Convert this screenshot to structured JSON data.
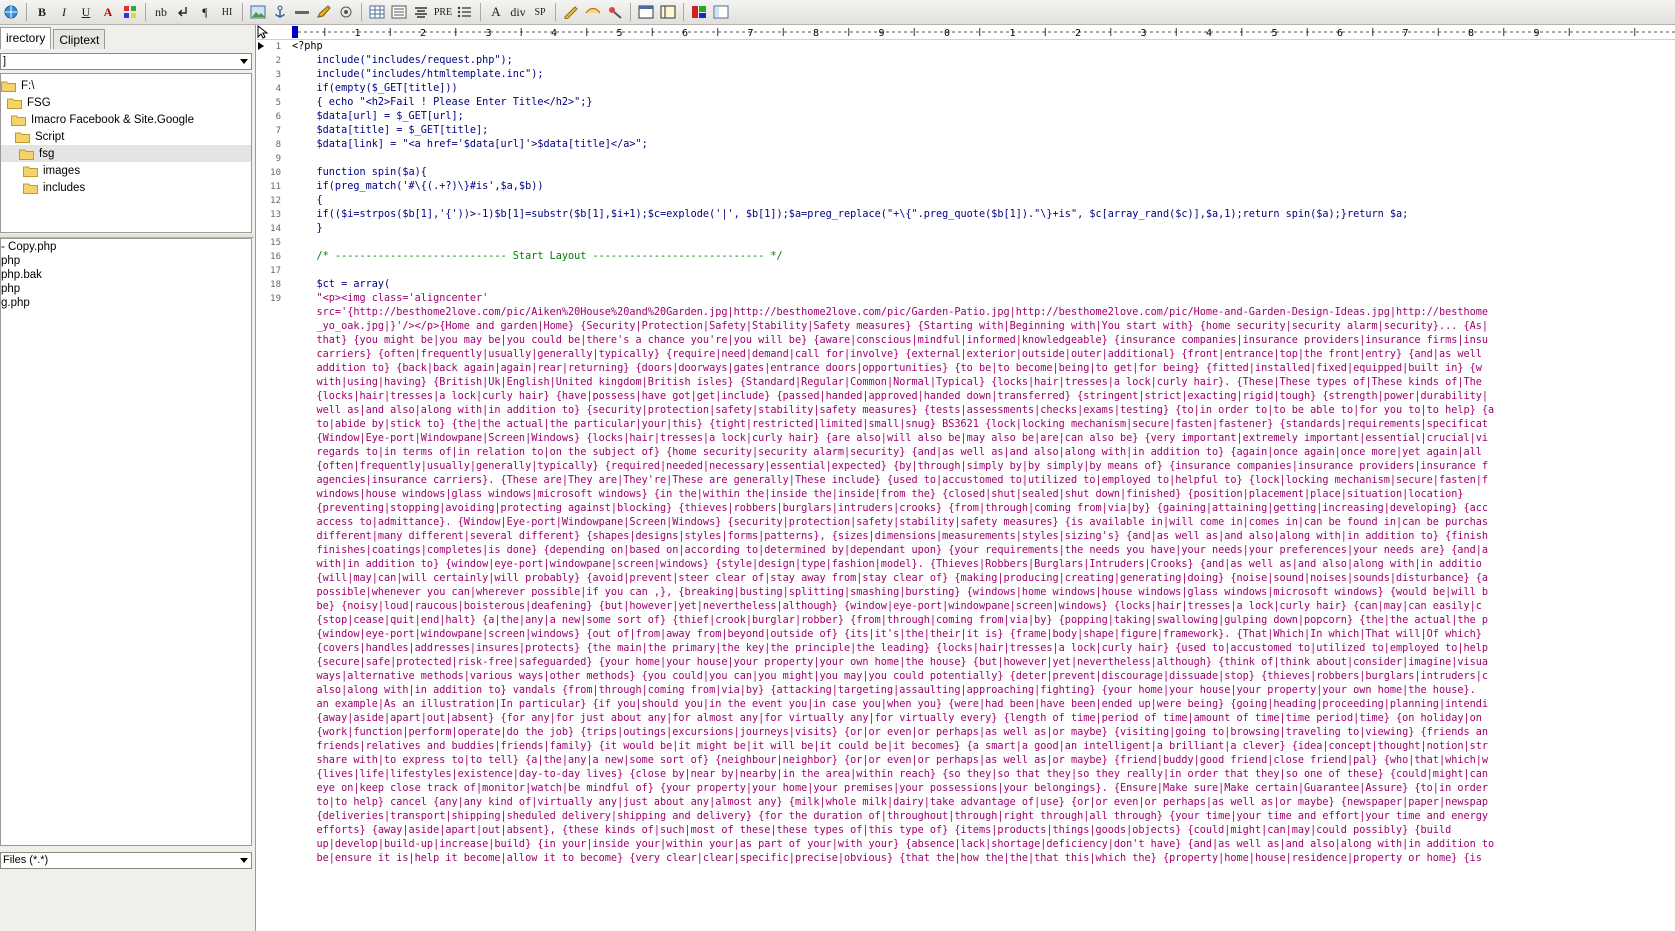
{
  "toolbar": {
    "buttons": [
      {
        "name": "globe-icon",
        "label": ""
      },
      {
        "name": "bold-button",
        "label": "B"
      },
      {
        "name": "italic-button",
        "label": "I"
      },
      {
        "name": "underline-button",
        "label": "U"
      },
      {
        "name": "font-color-button",
        "label": "A"
      },
      {
        "name": "color-grid-button",
        "label": ""
      },
      {
        "name": "nbsp-button",
        "label": "nb"
      },
      {
        "name": "break-button",
        "label": ""
      },
      {
        "name": "paragraph-button",
        "label": "¶"
      },
      {
        "name": "heading-button",
        "label": "HI"
      },
      {
        "name": "image-button",
        "label": ""
      },
      {
        "name": "anchor-button",
        "label": ""
      },
      {
        "name": "hr-button",
        "label": ""
      },
      {
        "name": "edit-button",
        "label": ""
      },
      {
        "name": "special-button",
        "label": ""
      },
      {
        "name": "table-button",
        "label": ""
      },
      {
        "name": "align-button",
        "label": ""
      },
      {
        "name": "center-button",
        "label": ""
      },
      {
        "name": "pre-button",
        "label": "PRE"
      },
      {
        "name": "list-button",
        "label": ""
      },
      {
        "name": "font-button",
        "label": "A"
      },
      {
        "name": "div-button",
        "label": "div"
      },
      {
        "name": "span-button",
        "label": "SP"
      },
      {
        "name": "tool-a-button",
        "label": ""
      },
      {
        "name": "tool-b-button",
        "label": ""
      },
      {
        "name": "tool-c-button",
        "label": ""
      },
      {
        "name": "frame-a-button",
        "label": ""
      },
      {
        "name": "frame-b-button",
        "label": ""
      },
      {
        "name": "color-palette-button",
        "label": ""
      },
      {
        "name": "panel-toggle-button",
        "label": ""
      }
    ]
  },
  "leftpanel": {
    "tabs": [
      "irectory",
      "Cliptext"
    ],
    "drive_value": "]",
    "tree": [
      {
        "label": "F:\\",
        "indent": 0
      },
      {
        "label": "FSG",
        "indent": 1
      },
      {
        "label": "Imacro Facebook & Site.Google",
        "indent": 2
      },
      {
        "label": "Script",
        "indent": 3
      },
      {
        "label": "fsg",
        "indent": 4,
        "selected": true
      },
      {
        "label": "images",
        "indent": 5
      },
      {
        "label": "includes",
        "indent": 5
      }
    ],
    "files": [
      "- Copy.php",
      "php",
      "php.bak",
      "php",
      "g.php"
    ],
    "filter_value": "Files (*.*)"
  },
  "ruler": {
    "labels": [
      "1",
      "2",
      "3",
      "4",
      "5",
      "6",
      "7",
      "8",
      "9",
      "0",
      "1",
      "2",
      "3",
      "4",
      "5",
      "6",
      "7",
      "8",
      "9"
    ]
  },
  "editor": {
    "lines": [
      {
        "n": "1",
        "text": "<?php",
        "cls": "php"
      },
      {
        "n": "2",
        "text": "    include(\"includes/request.php\");",
        "cls": "code"
      },
      {
        "n": "3",
        "text": "    include(\"includes/htmltemplate.inc\");",
        "cls": "code"
      },
      {
        "n": "4",
        "text": "    if(empty($_GET[title]))",
        "cls": "code"
      },
      {
        "n": "5",
        "text": "    { echo \"<h2>Fail ! Please Enter Title</h2>\";}",
        "cls": "code"
      },
      {
        "n": "6",
        "text": "    $data[url] = $_GET[url];",
        "cls": "code"
      },
      {
        "n": "7",
        "text": "    $data[title] = $_GET[title];",
        "cls": "code"
      },
      {
        "n": "8",
        "text": "    $data[link] = \"<a href='$data[url]'>$data[title]</a>\";",
        "cls": "code"
      },
      {
        "n": "9",
        "text": "",
        "cls": "code"
      },
      {
        "n": "10",
        "text": "    function spin($a){",
        "cls": "code"
      },
      {
        "n": "11",
        "text": "    if(preg_match('#\\{(.+?)\\}#is',$a,$b))",
        "cls": "code"
      },
      {
        "n": "12",
        "text": "    {",
        "cls": "code"
      },
      {
        "n": "13",
        "text": "    if(($i=strpos($b[1],'{'))>-1)$b[1]=substr($b[1],$i+1);$c=explode('|', $b[1]);$a=preg_replace(\"+\\{\".preg_quote($b[1]).\"\\}+is\", $c[array_rand($c)],$a,1);return spin($a);}return $a;",
        "cls": "code"
      },
      {
        "n": "14",
        "text": "    }",
        "cls": "code"
      },
      {
        "n": "15",
        "text": "",
        "cls": "code"
      },
      {
        "n": "16",
        "text": "    /* ---------------------------- Start Layout ---------------------------- */",
        "cls": "cmt"
      },
      {
        "n": "17",
        "text": "",
        "cls": "code"
      },
      {
        "n": "18",
        "text": "    $ct = array(",
        "cls": "code"
      },
      {
        "n": "19",
        "text": "    \"<p><img class='aligncenter'",
        "cls": "str"
      },
      {
        "n": "",
        "text": "    src='{http://besthome2love.com/pic/Aiken%20House%20and%20Garden.jpg|http://besthome2love.com/pic/Garden-Patio.jpg|http://besthome2love.com/pic/Home-and-Garden-Design-Ideas.jpg|http://besthome",
        "cls": "str"
      },
      {
        "n": "",
        "text": "    _yo_oak.jpg|}'/></p>{Home and garden|Home} {Security|Protection|Safety|Stability|Safety measures} {Starting with|Beginning with|You start with} {home security|security alarm|security}... {As|",
        "cls": "str"
      },
      {
        "n": "",
        "text": "    that} {you might be|you may be|you could be|there's a chance you're|you will be} {aware|conscious|mindful|informed|knowledgeable} {insurance companies|insurance providers|insurance firms|insu",
        "cls": "str"
      },
      {
        "n": "",
        "text": "    carriers} {often|frequently|usually|generally|typically} {require|need|demand|call for|involve} {external|exterior|outside|outer|additional} {front|entrance|top|the front|entry} {and|as well",
        "cls": "str"
      },
      {
        "n": "",
        "text": "    addition to} {back|back again|again|rear|returning} {doors|doorways|gates|entrance doors|opportunities} {to be|to become|being|to get|for being} {fitted|installed|fixed|equipped|built in} {w",
        "cls": "str"
      },
      {
        "n": "",
        "text": "    with|using|having} {British|Uk|English|United kingdom|British isles} {Standard|Regular|Common|Normal|Typical} {locks|hair|tresses|a lock|curly hair}. {These|These types of|These kinds of|The",
        "cls": "str"
      },
      {
        "n": "",
        "text": "    {locks|hair|tresses|a lock|curly hair} {have|possess|have got|get|include} {passed|handed|approved|handed down|transferred} {stringent|strict|exacting|rigid|tough} {strength|power|durability|",
        "cls": "str"
      },
      {
        "n": "",
        "text": "    well as|and also|along with|in addition to} {security|protection|safety|stability|safety measures} {tests|assessments|checks|exams|testing} {to|in order to|to be able to|for you to|to help} {a",
        "cls": "str"
      },
      {
        "n": "",
        "text": "    to|abide by|stick to} {the|the actual|the particular|your|this} {tight|restricted|limited|small|snug} BS3621 {lock|locking mechanism|secure|fasten|fastener} {standards|requirements|specificat",
        "cls": "str"
      },
      {
        "n": "",
        "text": "    {Window|Eye-port|Windowpane|Screen|Windows} {locks|hair|tresses|a lock|curly hair} {are also|will also be|may also be|are|can also be} {very important|extremely important|essential|crucial|vi",
        "cls": "str"
      },
      {
        "n": "",
        "text": "    regards to|in terms of|in relation to|on the subject of} {home security|security alarm|security} {and|as well as|and also|along with|in addition to} {again|once again|once more|yet again|all",
        "cls": "str"
      },
      {
        "n": "",
        "text": "    {often|frequently|usually|generally|typically} {required|needed|necessary|essential|expected} {by|through|simply by|by simply|by means of} {insurance companies|insurance providers|insurance f",
        "cls": "str"
      },
      {
        "n": "",
        "text": "    agencies|insurance carriers}. {These are|They are|They're|These are generally|These include} {used to|accustomed to|utilized to|employed to|helpful to} {lock|locking mechanism|secure|fasten|f",
        "cls": "str"
      },
      {
        "n": "",
        "text": "    windows|house windows|glass windows|microsoft windows} {in the|within the|inside the|inside|from the} {closed|shut|sealed|shut down|finished} {position|placement|place|situation|location}",
        "cls": "str"
      },
      {
        "n": "",
        "text": "    {preventing|stopping|avoiding|protecting against|blocking} {thieves|robbers|burglars|intruders|crooks} {from|through|coming from|via|by} {gaining|attaining|getting|increasing|developing} {acc",
        "cls": "str"
      },
      {
        "n": "",
        "text": "    access to|admittance}. {Window|Eye-port|Windowpane|Screen|Windows} {security|protection|safety|stability|safety measures} {is available in|will come in|comes in|can be found in|can be purchas",
        "cls": "str"
      },
      {
        "n": "",
        "text": "    different|many different|several different} {shapes|designs|styles|forms|patterns}, {sizes|dimensions|measurements|styles|sizing's} {and|as well as|and also|along with|in addition to} {finish",
        "cls": "str"
      },
      {
        "n": "",
        "text": "    finishes|coatings|completes|is done} {depending on|based on|according to|determined by|dependant upon} {your requirements|the needs you have|your needs|your preferences|your needs are} {and|a",
        "cls": "str"
      },
      {
        "n": "",
        "text": "    with|in addition to} {window|eye-port|windowpane|screen|windows} {style|design|type|fashion|model}. {Thieves|Robbers|Burglars|Intruders|Crooks} {and|as well as|and also|along with|in additio",
        "cls": "str"
      },
      {
        "n": "",
        "text": "    {will|may|can|will certainly|will probably} {avoid|prevent|steer clear of|stay away from|stay clear of} {making|producing|creating|generating|doing} {noise|sound|noises|sounds|disturbance} {a",
        "cls": "str"
      },
      {
        "n": "",
        "text": "    possible|whenever you can|wherever possible|if you can ,}, {breaking|busting|splitting|smashing|bursting} {windows|home windows|house windows|glass windows|microsoft windows} {would be|will b",
        "cls": "str"
      },
      {
        "n": "",
        "text": "    be} {noisy|loud|raucous|boisterous|deafening} {but|however|yet|nevertheless|although} {window|eye-port|windowpane|screen|windows} {locks|hair|tresses|a lock|curly hair} {can|may|can easily|c",
        "cls": "str"
      },
      {
        "n": "",
        "text": "    {stop|cease|quit|end|halt} {a|the|any|a new|some sort of} {thief|crook|burglar|robber} {from|through|coming from|via|by} {popping|taking|swallowing|gulping down|popcorn} {the|the actual|the p",
        "cls": "str"
      },
      {
        "n": "",
        "text": "    {window|eye-port|windowpane|screen|windows} {out of|from|away from|beyond|outside of} {its|it's|the|their|it is} {frame|body|shape|figure|framework}. {That|Which|In which|That will|Of which}",
        "cls": "str"
      },
      {
        "n": "",
        "text": "    {covers|handles|addresses|insures|protects} {the main|the primary|the key|the principle|the leading} {locks|hair|tresses|a lock|curly hair} {used to|accustomed to|utilized to|employed to|help",
        "cls": "str"
      },
      {
        "n": "",
        "text": "    {secure|safe|protected|risk-free|safeguarded} {your home|your house|your property|your own home|the house} {but|however|yet|nevertheless|although} {think of|think about|consider|imagine|visua",
        "cls": "str"
      },
      {
        "n": "",
        "text": "    ways|alternative methods|various ways|other methods} {you could|you can|you might|you may|you could potentially} {deter|prevent|discourage|dissuade|stop} {thieves|robbers|burglars|intruders|c",
        "cls": "str"
      },
      {
        "n": "",
        "text": "    also|along with|in addition to} vandals {from|through|coming from|via|by} {attacking|targeting|assaulting|approaching|fighting} {your home|your house|your property|your own home|the house}.",
        "cls": "str"
      },
      {
        "n": "",
        "text": "    an example|As an illustration|In particular} {if you|should you|in the event you|in case you|when you} {were|had been|have been|ended up|were being} {going|heading|proceeding|planning|intendi",
        "cls": "str"
      },
      {
        "n": "",
        "text": "    {away|aside|apart|out|absent} {for any|for just about any|for almost any|for virtually any|for virtually every} {length of time|period of time|amount of time|time period|time} {on holiday|on",
        "cls": "str"
      },
      {
        "n": "",
        "text": "    {work|function|perform|operate|do the job} {trips|outings|excursions|journeys|visits} {or|or even|or perhaps|as well as|or maybe} {visiting|going to|browsing|traveling to|viewing} {friends an",
        "cls": "str"
      },
      {
        "n": "",
        "text": "    friends|relatives and buddies|friends|family} {it would be|it might be|it will be|it could be|it becomes} {a smart|a good|an intelligent|a brilliant|a clever} {idea|concept|thought|notion|str",
        "cls": "str"
      },
      {
        "n": "",
        "text": "    share with|to express to|to tell} {a|the|any|a new|some sort of} {neighbour|neighbor} {or|or even|or perhaps|as well as|or maybe} {friend|buddy|good friend|close friend|pal} {who|that|which|w",
        "cls": "str"
      },
      {
        "n": "",
        "text": "    {lives|life|lifestyles|existence|day-to-day lives} {close by|near by|nearby|in the area|within reach} {so they|so that they|so they really|in order that they|so one of these} {could|might|can",
        "cls": "str"
      },
      {
        "n": "",
        "text": "    eye on|keep close track of|monitor|watch|be mindful of} {your property|your home|your premises|your possessions|your belongings}. {Ensure|Make sure|Make certain|Guarantee|Assure} {to|in order",
        "cls": "str"
      },
      {
        "n": "",
        "text": "    to|to help} cancel {any|any kind of|virtually any|just about any|almost any} {milk|whole milk|dairy|take advantage of|use} {or|or even|or perhaps|as well as|or maybe} {newspaper|paper|newspap",
        "cls": "str"
      },
      {
        "n": "",
        "text": "    {deliveries|transport|shipping|sheduled delivery|shipping and delivery} {for the duration of|throughout|through|right through|all through} {your time|your time and effort|your time and energy",
        "cls": "str"
      },
      {
        "n": "",
        "text": "    efforts} {away|aside|apart|out|absent}, {these kinds of|such|most of these|these types of|this type of} {items|products|things|goods|objects} {could|might|can|may|could possibly} {build",
        "cls": "str"
      },
      {
        "n": "",
        "text": "    up|develop|build-up|increase|build} {in your|inside your|within your|as part of your|with your} {absence|lack|shortage|deficiency|don't have} {and|as well as|and also|along with|in addition to",
        "cls": "str"
      },
      {
        "n": "",
        "text": "    be|ensure it is|help it become|allow it to become} {very clear|clear|specific|precise|obvious} {that the|how the|the|that this|which the} {property|home|house|residence|property or home} {is",
        "cls": "str"
      }
    ]
  }
}
